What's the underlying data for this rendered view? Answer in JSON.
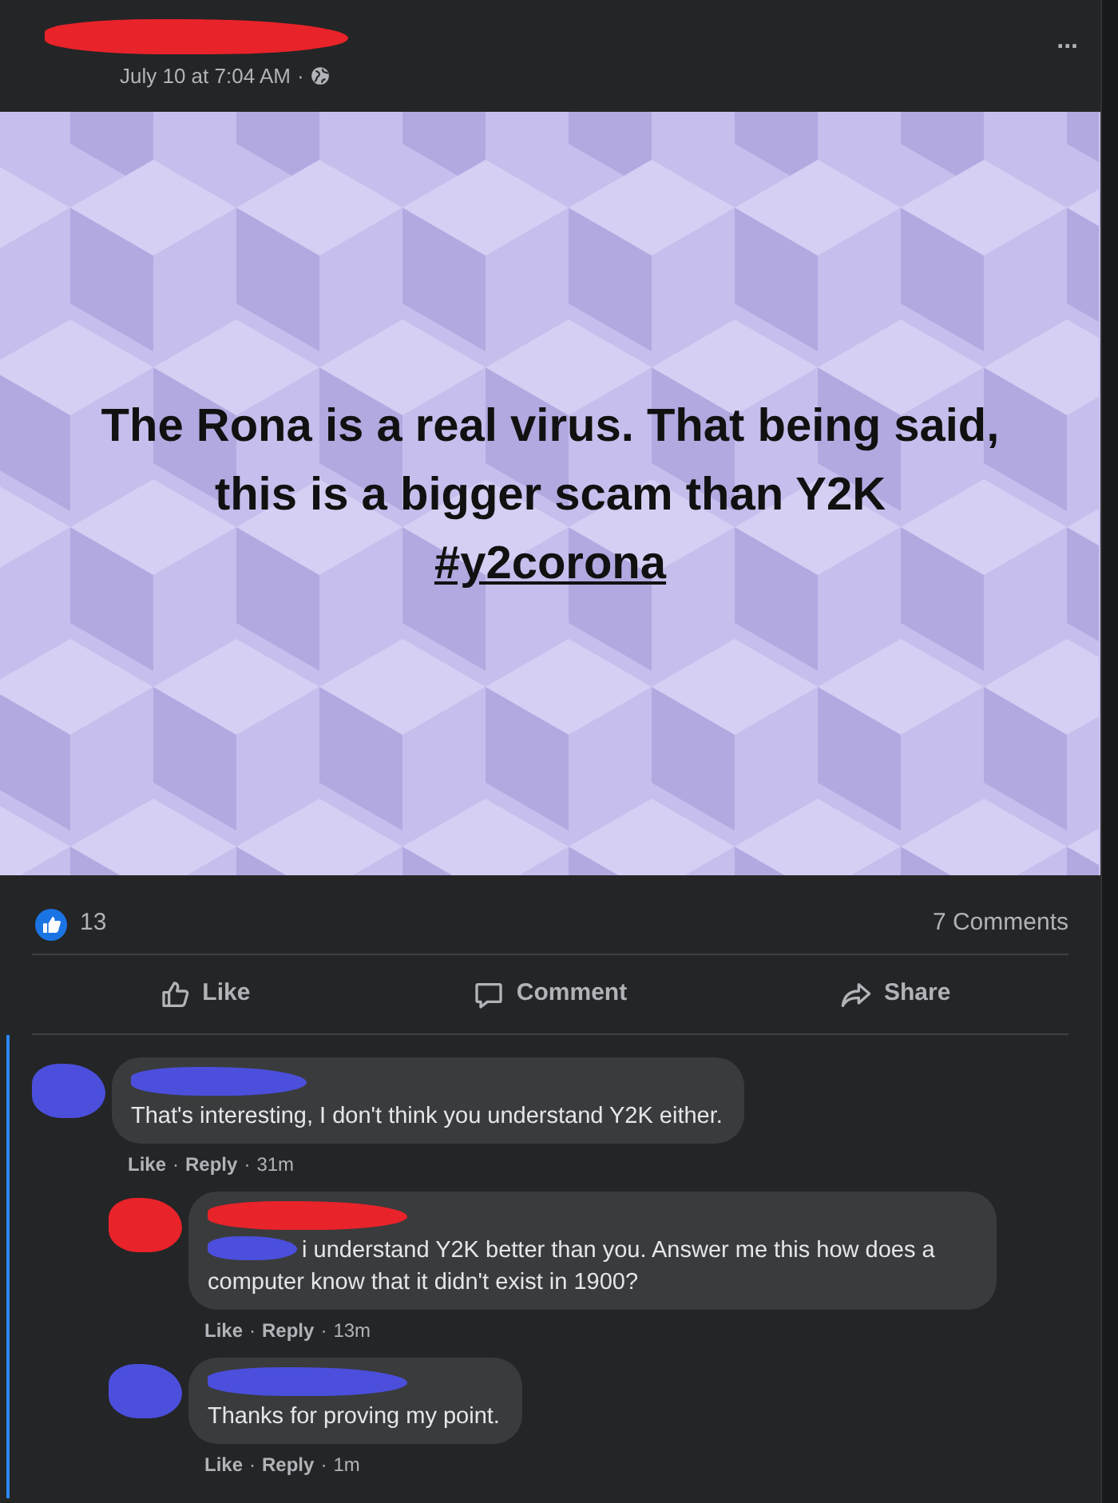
{
  "post": {
    "author": {
      "color": "#e8232a"
    },
    "timestamp": "July 10 at 7:04 AM",
    "separator": "·",
    "menu": "...",
    "image_text": {
      "text": "The Rona is a real virus. That being said, this is a bigger scam than Y2K",
      "hashtag": "#y2corona"
    },
    "reactions": {
      "kind": "like",
      "count": "13"
    },
    "comments_count": "7 Comments",
    "actions": [
      {
        "kind": "like",
        "label": "Like"
      },
      {
        "kind": "comment",
        "label": "Comment"
      },
      {
        "kind": "share",
        "label": "Share"
      }
    ]
  },
  "comments": [
    {
      "color": "#4b4fdc",
      "text": "That's interesting, I don't think you understand Y2K either.",
      "links": [
        "Like",
        "Reply"
      ],
      "separator": "·",
      "time": "31m",
      "children": [
        {
          "color": "#e8232a",
          "mention": {
            "color": "#4b4fdc"
          },
          "text": "i understand Y2K better than you. Answer me this how does a computer know that it didn't exist in 1900?",
          "links": [
            "Like",
            "Reply"
          ],
          "separator": "·",
          "time": "13m"
        },
        {
          "color": "#4b4fdc",
          "text": "Thanks for proving my point.",
          "links": [
            "Like",
            "Reply"
          ],
          "separator": "·",
          "time": "1m"
        }
      ]
    }
  ]
}
